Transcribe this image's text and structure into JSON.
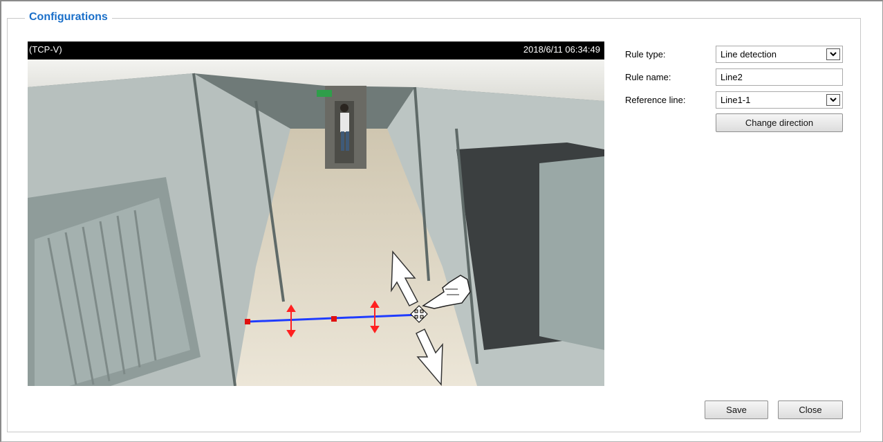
{
  "section": {
    "legend": "Configurations"
  },
  "viewer": {
    "source_label": "(TCP-V)",
    "timestamp": "2018/6/11 06:34:49"
  },
  "form": {
    "rule_type": {
      "label": "Rule type:",
      "value": "Line detection"
    },
    "rule_name": {
      "label": "Rule name:",
      "value": "Line2"
    },
    "reference_line": {
      "label": "Reference line:",
      "value": "Line1-1"
    },
    "change_direction_label": "Change direction"
  },
  "footer": {
    "save_label": "Save",
    "close_label": "Close"
  },
  "colors": {
    "legend": "#1a6fc9",
    "detection_line": "#1f3cff",
    "line_handle": "#e01010",
    "direction_arrow": "#ff2020"
  }
}
